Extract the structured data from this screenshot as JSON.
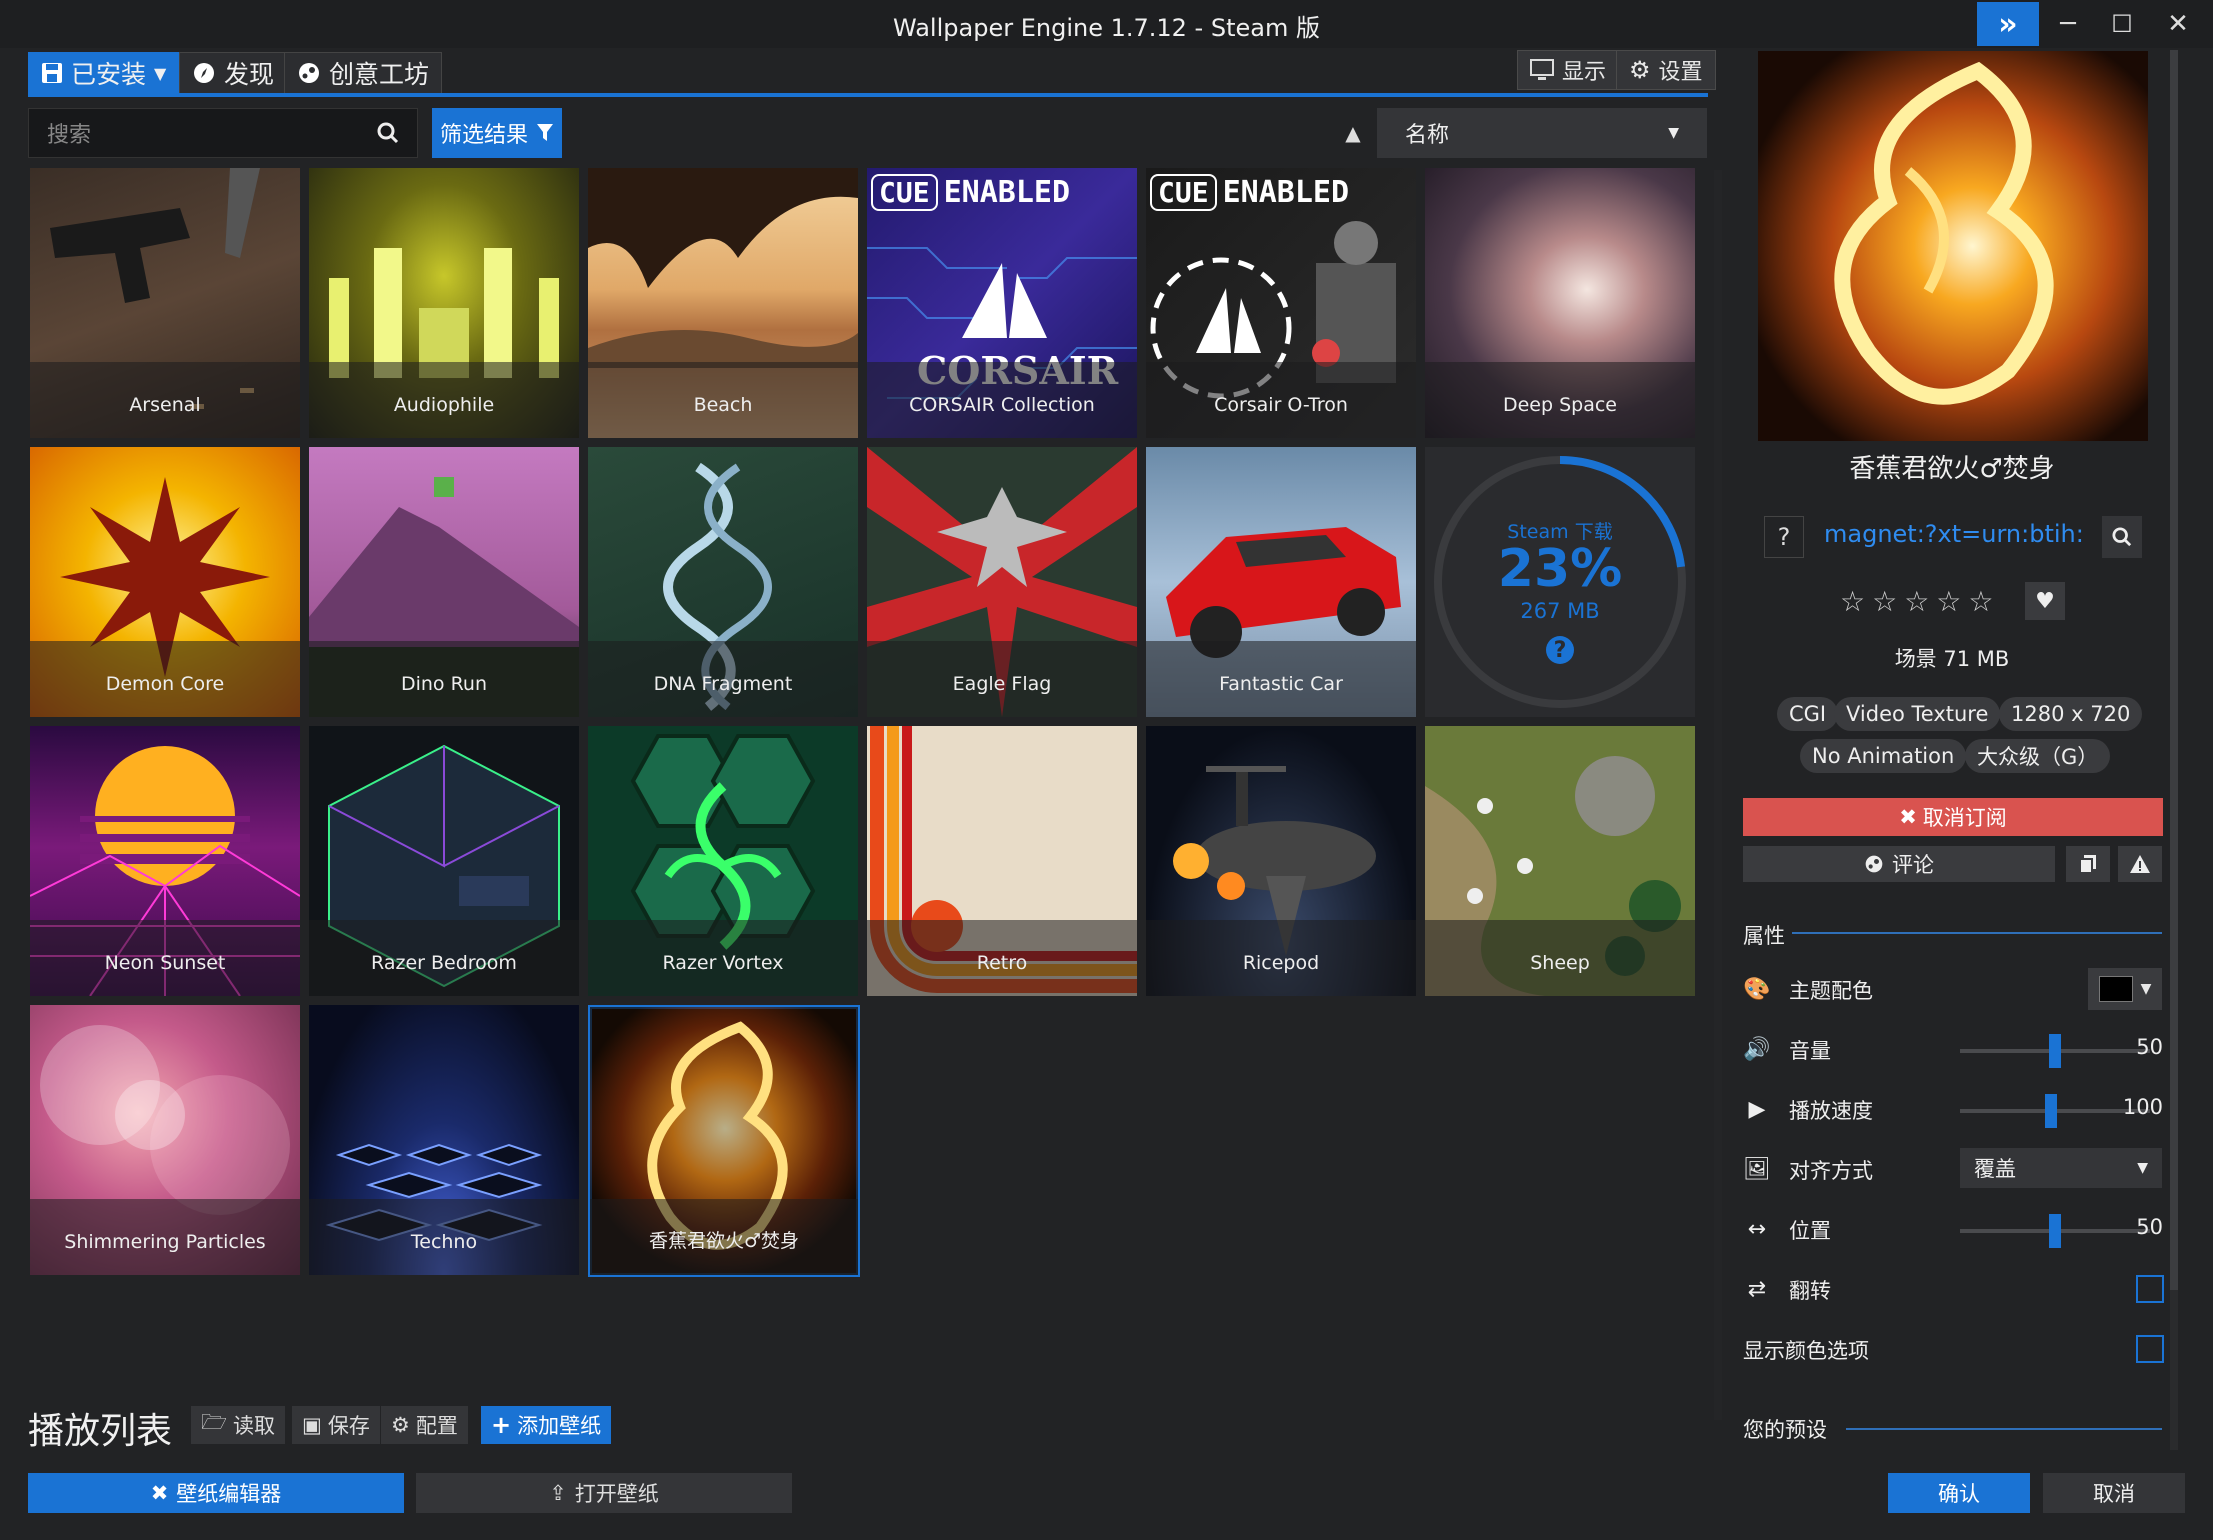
{
  "window": {
    "title": "Wallpaper Engine 1.7.12 - Steam 版",
    "expand_icon": "double-chevron-right-icon",
    "min": "─",
    "max": "☐",
    "close": "✕"
  },
  "tabs": [
    {
      "label": "已安装",
      "icon": "disk-icon"
    },
    {
      "label": "发现",
      "icon": "compass-icon"
    },
    {
      "label": "创意工坊",
      "icon": "steam-icon"
    }
  ],
  "top_buttons": {
    "display": "显示",
    "settings": "设置"
  },
  "search": {
    "placeholder": "搜索"
  },
  "filter_label": "筛选结果",
  "sort": {
    "value": "名称"
  },
  "wallpapers": [
    {
      "name": "Arsenal"
    },
    {
      "name": "Audiophile"
    },
    {
      "name": "Beach"
    },
    {
      "name": "CORSAIR Collection"
    },
    {
      "name": "Corsair O-Tron"
    },
    {
      "name": "Deep Space"
    },
    {
      "name": "Demon Core"
    },
    {
      "name": "Dino Run"
    },
    {
      "name": "DNA Fragment"
    },
    {
      "name": "Eagle Flag"
    },
    {
      "name": "Fantastic Car"
    },
    {
      "name": ""
    },
    {
      "name": "Neon Sunset"
    },
    {
      "name": "Razer Bedroom"
    },
    {
      "name": "Razer Vortex"
    },
    {
      "name": "Retro"
    },
    {
      "name": "Ricepod"
    },
    {
      "name": "Sheep"
    },
    {
      "name": "Shimmering Particles"
    },
    {
      "name": "Techno"
    },
    {
      "name": "香蕉君欲火♂焚身"
    }
  ],
  "cue": {
    "badge": "CUE",
    "text": "ENABLED",
    "corsair_word": "CORSAIR"
  },
  "download": {
    "label": "Steam 下载",
    "percent": "23%",
    "progress": 0.23,
    "size": "267 MB",
    "help": "?"
  },
  "playlist": {
    "title": "播放列表",
    "load": "读取",
    "save": "保存",
    "config": "配置",
    "add": "添加壁纸"
  },
  "bottom": {
    "editor": "壁纸编辑器",
    "open": "打开壁纸"
  },
  "details": {
    "name": "香蕉君欲火♂焚身",
    "help": "?",
    "magnet": "magnet:?xt=urn:btih:",
    "stars": "☆☆☆☆☆",
    "rating": 0,
    "size_text": "场景 71 MB",
    "tags": [
      "CGI",
      "Video Texture",
      "1280 x 720",
      "No Animation",
      "大众级（G）"
    ],
    "unsubscribe": "取消订阅",
    "comment": "评论"
  },
  "properties": {
    "heading": "属性",
    "theme_color": {
      "label": "主题配色",
      "value": "#000000"
    },
    "volume": {
      "label": "音量",
      "value": "50",
      "fraction": 0.5
    },
    "speed": {
      "label": "播放速度",
      "value": "100",
      "fraction": 0.48
    },
    "align": {
      "label": "对齐方式",
      "value": "覆盖"
    },
    "position": {
      "label": "位置",
      "value": "50",
      "fraction": 0.5
    },
    "flip": {
      "label": "翻转",
      "checked": false
    },
    "show_color": {
      "label": "显示颜色选项",
      "checked": false
    }
  },
  "presets_heading": "您的预设",
  "footer": {
    "confirm": "确认",
    "cancel": "取消"
  },
  "colors": {
    "accent": "#1a73d4",
    "danger": "#d9534f",
    "bg": "#222325"
  }
}
